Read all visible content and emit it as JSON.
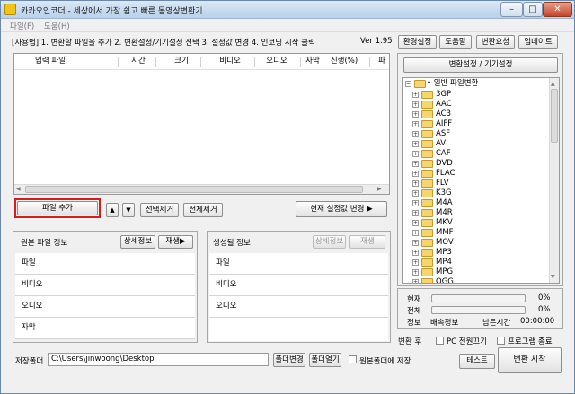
{
  "window": {
    "title": "카카오인코더 - 세상에서 가장 쉽고 빠른 동영상변환기",
    "minimize": "–",
    "maximize": "□",
    "close": "✕"
  },
  "menu": [
    "파일(F)",
    "도움(H)"
  ],
  "toolbar": {
    "steps": "[사용법] 1. 변환할 파일을 추가  2. 변환설정/기기설정 선택  3. 설정값 변경  4. 인코딩 시작 클릭",
    "version": "Ver 1.95",
    "buttons": [
      "환경설정",
      "도움말",
      "변환요청",
      "업데이트"
    ]
  },
  "file_list": {
    "columns": [
      "입력 파일",
      "시간",
      "크기",
      "비디오",
      "오디오",
      "자막",
      "진행(%)",
      "파"
    ]
  },
  "actions": {
    "add_file": "파일 추가",
    "up": "▲",
    "down": "▼",
    "remove_selected": "선택제거",
    "remove_all": "전체제거",
    "change_settings": "현재 설정값 변경 ▶"
  },
  "source_info": {
    "title": "원본 파일 정보",
    "detail": "상세정보",
    "play": "재생▶",
    "rows": [
      "파일",
      "비디오",
      "오디오",
      "자막"
    ]
  },
  "output_info": {
    "title": "생성될 정보",
    "detail": "상세정보",
    "play": "재생",
    "rows": [
      "파일",
      "비디오",
      "오디오"
    ]
  },
  "settings_panel": {
    "title": "변환설정 / 기기설정",
    "root": "일반 파일변환",
    "formats": [
      "3GP",
      "AAC",
      "AC3",
      "AIFF",
      "ASF",
      "AVI",
      "CAF",
      "DVD",
      "FLAC",
      "FLV",
      "K3G",
      "M4A",
      "M4R",
      "MKV",
      "MMF",
      "MOV",
      "MP3",
      "MP4",
      "MPG",
      "OGG"
    ]
  },
  "progress": {
    "current_label": "현재",
    "current_value": 0,
    "current_pct": "0%",
    "total_label": "전체",
    "total_value": 0,
    "total_pct": "0%",
    "info_label": "정보",
    "speed_label": "배속정보",
    "remaining_label": "남은시간",
    "remaining_time": "00:00:00"
  },
  "after_convert": {
    "label": "변환 후",
    "pc_off": "PC 전원끄기",
    "exit_program": "프로그램 종료"
  },
  "save": {
    "label": "저장폴더",
    "path": "C:\\Users\\jinwoong\\Desktop",
    "change_folder": "폴더변경",
    "open_folder": "폴더열기",
    "same_as_source": "원본폴더에 저장"
  },
  "bottom": {
    "test": "테스트",
    "start": "변환 시작"
  }
}
